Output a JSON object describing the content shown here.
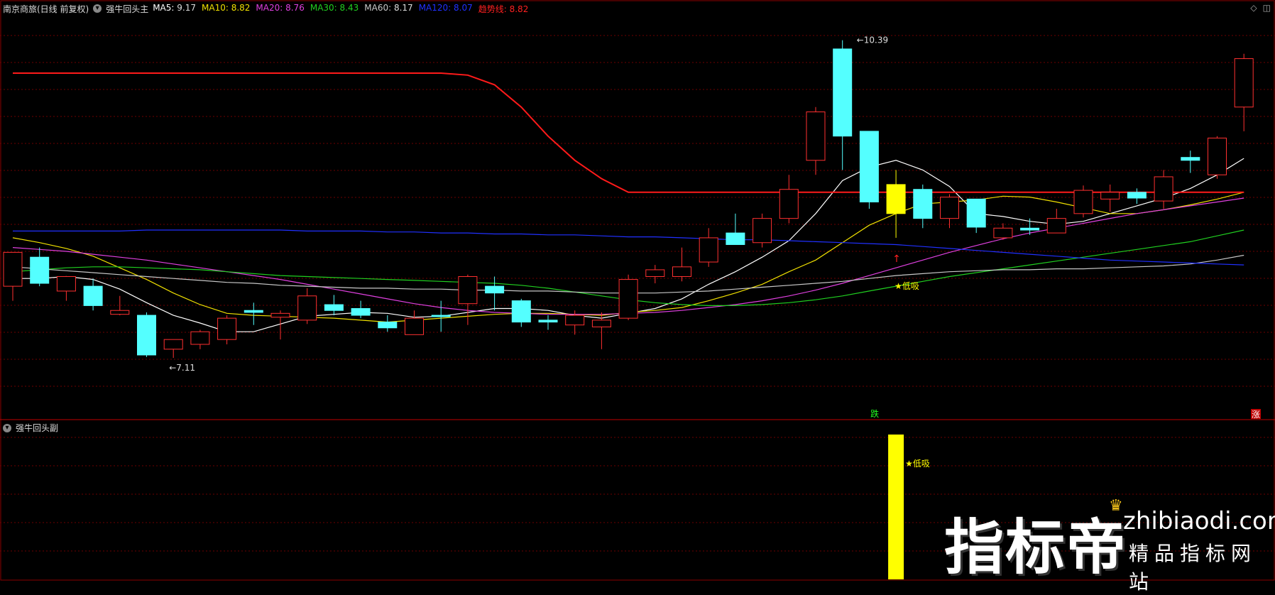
{
  "header": {
    "stock_name": "南京商旅(日线 前复权)",
    "indicator_name": "强牛回头主",
    "ma_items": [
      {
        "label": "MA5:",
        "value": "9.17",
        "color": "#ffffff"
      },
      {
        "label": "MA10:",
        "value": "8.82",
        "color": "#f0e000"
      },
      {
        "label": "MA20:",
        "value": "8.76",
        "color": "#e040e0"
      },
      {
        "label": "MA30:",
        "value": "8.43",
        "color": "#20d020"
      },
      {
        "label": "MA60:",
        "value": "8.17",
        "color": "#c8c8c8"
      },
      {
        "label": "MA120:",
        "value": "8.07",
        "color": "#2030ff"
      },
      {
        "label": "趋势线:",
        "value": "8.82",
        "color": "#ff2020"
      }
    ]
  },
  "sub_panel": {
    "title": "强牛回头副",
    "signal_label": "★低吸"
  },
  "watermark": {
    "brand": "指标帝",
    "site": "zhibiaodi.com",
    "tagline": "精品指标网站"
  },
  "colors": {
    "up": "#ff3030",
    "down": "#54ffff",
    "signal": "#ffff00",
    "grid": "#6e0000",
    "trend": "#ff1a1a"
  },
  "chart_data": {
    "type": "candlestick",
    "title": "",
    "ylim": [
      6.7,
      10.6
    ],
    "annotations": {
      "high_label": "10.39",
      "low_label": "7.11",
      "signal_text": "★低吸",
      "fall_label": "跌",
      "rise_label": "涨"
    },
    "candles": [
      {
        "o": 7.85,
        "h": 8.05,
        "l": 7.7,
        "c": 8.2,
        "color": "up"
      },
      {
        "o": 8.15,
        "h": 8.25,
        "l": 7.85,
        "c": 7.88,
        "color": "down"
      },
      {
        "o": 7.8,
        "h": 7.95,
        "l": 7.7,
        "c": 7.95,
        "color": "up"
      },
      {
        "o": 7.85,
        "h": 7.93,
        "l": 7.6,
        "c": 7.65,
        "color": "down"
      },
      {
        "o": 7.56,
        "h": 7.75,
        "l": 7.55,
        "c": 7.6,
        "color": "up"
      },
      {
        "o": 7.55,
        "h": 7.58,
        "l": 7.12,
        "c": 7.14,
        "color": "down"
      },
      {
        "o": 7.2,
        "h": 7.3,
        "l": 7.11,
        "c": 7.3,
        "color": "up"
      },
      {
        "o": 7.25,
        "h": 7.4,
        "l": 7.2,
        "c": 7.38,
        "color": "up"
      },
      {
        "o": 7.3,
        "h": 7.55,
        "l": 7.25,
        "c": 7.52,
        "color": "up"
      },
      {
        "o": 7.6,
        "h": 7.68,
        "l": 7.45,
        "c": 7.58,
        "color": "down"
      },
      {
        "o": 7.53,
        "h": 7.6,
        "l": 7.3,
        "c": 7.57,
        "color": "up"
      },
      {
        "o": 7.5,
        "h": 7.83,
        "l": 7.46,
        "c": 7.75,
        "color": "up"
      },
      {
        "o": 7.66,
        "h": 7.76,
        "l": 7.55,
        "c": 7.6,
        "color": "down"
      },
      {
        "o": 7.62,
        "h": 7.7,
        "l": 7.52,
        "c": 7.55,
        "color": "down"
      },
      {
        "o": 7.48,
        "h": 7.55,
        "l": 7.38,
        "c": 7.42,
        "color": "down"
      },
      {
        "o": 7.35,
        "h": 7.6,
        "l": 7.36,
        "c": 7.52,
        "color": "up"
      },
      {
        "o": 7.55,
        "h": 7.7,
        "l": 7.38,
        "c": 7.55,
        "color": "down"
      },
      {
        "o": 7.67,
        "h": 7.97,
        "l": 7.45,
        "c": 7.95,
        "color": "up"
      },
      {
        "o": 7.85,
        "h": 7.95,
        "l": 7.6,
        "c": 7.78,
        "color": "down"
      },
      {
        "o": 7.7,
        "h": 7.72,
        "l": 7.43,
        "c": 7.48,
        "color": "down"
      },
      {
        "o": 7.5,
        "h": 7.55,
        "l": 7.4,
        "c": 7.48,
        "color": "down"
      },
      {
        "o": 7.45,
        "h": 7.6,
        "l": 7.35,
        "c": 7.55,
        "color": "up"
      },
      {
        "o": 7.43,
        "h": 7.58,
        "l": 7.2,
        "c": 7.5,
        "color": "up"
      },
      {
        "o": 7.52,
        "h": 7.97,
        "l": 7.5,
        "c": 7.92,
        "color": "up"
      },
      {
        "o": 7.95,
        "h": 8.07,
        "l": 7.88,
        "c": 8.02,
        "color": "up"
      },
      {
        "o": 7.95,
        "h": 8.25,
        "l": 7.9,
        "c": 8.05,
        "color": "up"
      },
      {
        "o": 8.1,
        "h": 8.45,
        "l": 8.05,
        "c": 8.35,
        "color": "up"
      },
      {
        "o": 8.4,
        "h": 8.6,
        "l": 8.3,
        "c": 8.28,
        "color": "down"
      },
      {
        "o": 8.3,
        "h": 8.6,
        "l": 8.25,
        "c": 8.55,
        "color": "up"
      },
      {
        "o": 8.55,
        "h": 9.0,
        "l": 8.5,
        "c": 8.85,
        "color": "up"
      },
      {
        "o": 9.15,
        "h": 9.7,
        "l": 9.0,
        "c": 9.65,
        "color": "up"
      },
      {
        "o": 10.3,
        "h": 10.39,
        "l": 9.05,
        "c": 9.4,
        "color": "down"
      },
      {
        "o": 9.45,
        "h": 9.45,
        "l": 8.65,
        "c": 8.72,
        "color": "down"
      },
      {
        "o": 8.9,
        "h": 9.05,
        "l": 8.35,
        "c": 8.6,
        "color": "signal"
      },
      {
        "o": 8.85,
        "h": 8.9,
        "l": 8.45,
        "c": 8.55,
        "color": "down"
      },
      {
        "o": 8.55,
        "h": 8.8,
        "l": 8.45,
        "c": 8.77,
        "color": "up"
      },
      {
        "o": 8.75,
        "h": 8.72,
        "l": 8.4,
        "c": 8.46,
        "color": "down"
      },
      {
        "o": 8.35,
        "h": 8.5,
        "l": 8.33,
        "c": 8.45,
        "color": "up"
      },
      {
        "o": 8.45,
        "h": 8.55,
        "l": 8.38,
        "c": 8.43,
        "color": "down"
      },
      {
        "o": 8.4,
        "h": 8.65,
        "l": 8.4,
        "c": 8.55,
        "color": "up"
      },
      {
        "o": 8.6,
        "h": 8.89,
        "l": 8.56,
        "c": 8.84,
        "color": "up"
      },
      {
        "o": 8.75,
        "h": 8.9,
        "l": 8.62,
        "c": 8.82,
        "color": "up"
      },
      {
        "o": 8.82,
        "h": 8.86,
        "l": 8.7,
        "c": 8.76,
        "color": "down"
      },
      {
        "o": 8.73,
        "h": 9.05,
        "l": 8.65,
        "c": 8.98,
        "color": "up"
      },
      {
        "o": 9.18,
        "h": 9.25,
        "l": 9.02,
        "c": 9.15,
        "color": "down"
      },
      {
        "o": 9.0,
        "h": 9.4,
        "l": 8.96,
        "c": 9.38,
        "color": "up"
      },
      {
        "o": 9.7,
        "h": 10.25,
        "l": 9.45,
        "c": 10.2,
        "color": "up"
      }
    ],
    "series": [
      {
        "name": "MA5",
        "color": "#ffffff",
        "values": [
          7.93,
          7.93,
          7.95,
          7.92,
          7.82,
          7.68,
          7.55,
          7.47,
          7.38,
          7.38,
          7.46,
          7.54,
          7.56,
          7.58,
          7.57,
          7.53,
          7.54,
          7.58,
          7.62,
          7.62,
          7.6,
          7.55,
          7.52,
          7.57,
          7.62,
          7.72,
          7.87,
          8.0,
          8.15,
          8.32,
          8.6,
          8.94,
          9.08,
          9.15,
          9.05,
          8.88,
          8.6,
          8.57,
          8.52,
          8.49,
          8.52,
          8.6,
          8.68,
          8.76,
          8.86,
          9.0,
          9.17
        ]
      },
      {
        "name": "MA10",
        "color": "#f0e000",
        "values": [
          8.35,
          8.3,
          8.24,
          8.16,
          8.04,
          7.92,
          7.78,
          7.66,
          7.57,
          7.55,
          7.54,
          7.53,
          7.52,
          7.5,
          7.48,
          7.5,
          7.52,
          7.54,
          7.56,
          7.57,
          7.57,
          7.56,
          7.55,
          7.58,
          7.6,
          7.63,
          7.7,
          7.78,
          7.87,
          8.0,
          8.12,
          8.3,
          8.48,
          8.6,
          8.7,
          8.72,
          8.74,
          8.78,
          8.77,
          8.72,
          8.66,
          8.6,
          8.6,
          8.64,
          8.69,
          8.75,
          8.82
        ]
      },
      {
        "name": "MA20",
        "color": "#e040e0",
        "values": [
          8.25,
          8.23,
          8.21,
          8.18,
          8.15,
          8.12,
          8.08,
          8.04,
          8.0,
          7.96,
          7.92,
          7.87,
          7.82,
          7.77,
          7.72,
          7.67,
          7.63,
          7.6,
          7.58,
          7.57,
          7.56,
          7.56,
          7.56,
          7.57,
          7.58,
          7.6,
          7.63,
          7.66,
          7.7,
          7.75,
          7.81,
          7.88,
          7.96,
          8.04,
          8.12,
          8.2,
          8.27,
          8.34,
          8.4,
          8.45,
          8.5,
          8.55,
          8.6,
          8.64,
          8.68,
          8.72,
          8.76
        ]
      },
      {
        "name": "MA30",
        "color": "#20d020",
        "values": [
          8.0,
          8.02,
          8.04,
          8.05,
          8.05,
          8.04,
          8.03,
          8.02,
          8.0,
          7.98,
          7.96,
          7.95,
          7.94,
          7.93,
          7.92,
          7.91,
          7.9,
          7.89,
          7.88,
          7.86,
          7.83,
          7.79,
          7.75,
          7.71,
          7.68,
          7.66,
          7.65,
          7.65,
          7.66,
          7.68,
          7.71,
          7.75,
          7.8,
          7.85,
          7.9,
          7.95,
          7.99,
          8.03,
          8.07,
          8.11,
          8.15,
          8.19,
          8.23,
          8.27,
          8.31,
          8.37,
          8.43
        ]
      },
      {
        "name": "MA60",
        "color": "#c8c8c8",
        "values": [
          8.05,
          8.03,
          8.01,
          7.99,
          7.97,
          7.95,
          7.93,
          7.91,
          7.89,
          7.88,
          7.86,
          7.85,
          7.84,
          7.83,
          7.83,
          7.82,
          7.82,
          7.81,
          7.81,
          7.8,
          7.8,
          7.79,
          7.78,
          7.78,
          7.78,
          7.79,
          7.8,
          7.82,
          7.84,
          7.86,
          7.88,
          7.9,
          7.93,
          7.96,
          7.98,
          8.0,
          8.01,
          8.02,
          8.02,
          8.03,
          8.03,
          8.04,
          8.05,
          8.06,
          8.08,
          8.12,
          8.17
        ]
      },
      {
        "name": "MA120",
        "color": "#2030ff",
        "values": [
          8.42,
          8.42,
          8.42,
          8.42,
          8.42,
          8.43,
          8.43,
          8.43,
          8.43,
          8.43,
          8.43,
          8.42,
          8.42,
          8.42,
          8.41,
          8.41,
          8.4,
          8.4,
          8.39,
          8.39,
          8.38,
          8.38,
          8.37,
          8.36,
          8.36,
          8.35,
          8.34,
          8.33,
          8.33,
          8.32,
          8.31,
          8.3,
          8.29,
          8.28,
          8.26,
          8.24,
          8.22,
          8.2,
          8.18,
          8.16,
          8.14,
          8.12,
          8.11,
          8.1,
          8.09,
          8.08,
          8.07
        ]
      },
      {
        "name": "趋势线",
        "color": "#ff1a1a",
        "values": [
          10.05,
          10.05,
          10.05,
          10.05,
          10.05,
          10.05,
          10.05,
          10.05,
          10.05,
          10.05,
          10.05,
          10.05,
          10.05,
          10.05,
          10.05,
          10.05,
          10.05,
          10.03,
          9.93,
          9.7,
          9.4,
          9.15,
          8.96,
          8.82,
          8.82,
          8.82,
          8.82,
          8.82,
          8.82,
          8.82,
          8.82,
          8.82,
          8.82,
          8.82,
          8.82,
          8.82,
          8.82,
          8.82,
          8.82,
          8.82,
          8.82,
          8.82,
          8.82,
          8.82,
          8.82,
          8.82,
          8.82
        ]
      }
    ],
    "signals": [
      {
        "index": 33,
        "label": "★低吸"
      }
    ]
  }
}
